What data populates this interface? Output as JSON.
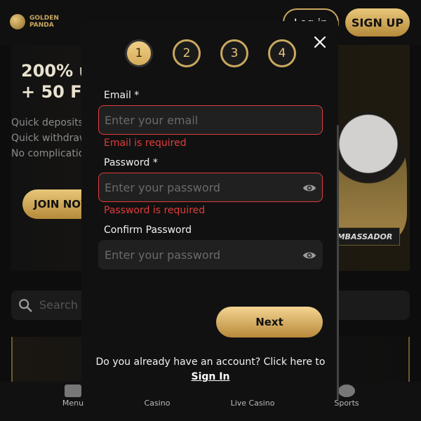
{
  "brand": {
    "logo_text_1": "GOLDEN",
    "logo_text_2": "PANDA"
  },
  "header": {
    "login_label": "Log in",
    "signup_label": "SIGN UP"
  },
  "hero": {
    "title_line_1": "200% u",
    "title_line_2": "+ 50 Fr",
    "sub_line_1": "Quick deposits",
    "sub_line_2": "Quick withdraw",
    "sub_line_3": "No complicatio",
    "join_label": "JOIN NOW",
    "ambassador_label": "MBASSADOR"
  },
  "search": {
    "placeholder": "Search"
  },
  "bottom_nav": [
    {
      "label": "Menu",
      "icon": "menu-icon"
    },
    {
      "label": "Casino",
      "icon": "casino-icon"
    },
    {
      "label": "Live Casino",
      "icon": "live-casino-icon"
    },
    {
      "label": "Sports",
      "icon": "sports-icon"
    }
  ],
  "modal": {
    "steps": [
      "1",
      "2",
      "3",
      "4"
    ],
    "current_step": 1,
    "email": {
      "label": "Email *",
      "placeholder": "Enter your email",
      "error": "Email is required"
    },
    "password": {
      "label": "Password *",
      "placeholder": "Enter your password",
      "error": "Password is required"
    },
    "confirm": {
      "label": "Confirm Password",
      "placeholder": "Enter your password"
    },
    "next_label": "Next",
    "footer_text": "Do you already have an account? Click here to",
    "signin_label": "Sign In"
  },
  "colors": {
    "accent_gold": "#e8c77a",
    "error_red": "#e23b3b"
  }
}
